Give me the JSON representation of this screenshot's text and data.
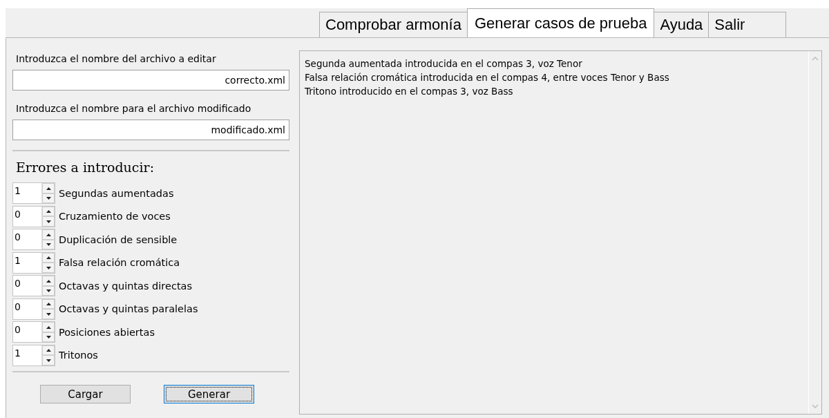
{
  "tabs": [
    {
      "label": "Comprobar armonía",
      "selected": false
    },
    {
      "label": "Generar casos de prueba",
      "selected": true
    },
    {
      "label": "Ayuda",
      "selected": false
    },
    {
      "label": "Salir",
      "selected": false
    }
  ],
  "source_file": {
    "label": "Introduzca el nombre del archivo a editar",
    "value": "correcto.xml"
  },
  "target_file": {
    "label": "Introduzca el nombre para el archivo modificado",
    "value": "modificado.xml"
  },
  "errors_heading": "Errores a introducir:",
  "errors": [
    {
      "value": "1",
      "label": "Segundas aumentadas"
    },
    {
      "value": "0",
      "label": "Cruzamiento de voces"
    },
    {
      "value": "0",
      "label": "Duplicación de sensible"
    },
    {
      "value": "1",
      "label": "Falsa relación cromática"
    },
    {
      "value": "0",
      "label": "Octavas y quintas directas"
    },
    {
      "value": "0",
      "label": "Octavas y quintas paralelas"
    },
    {
      "value": "0",
      "label": "Posiciones abiertas"
    },
    {
      "value": "1",
      "label": "Tritonos"
    }
  ],
  "buttons": [
    {
      "label": "Cargar",
      "focused": false
    },
    {
      "label": "Generar",
      "focused": true
    }
  ],
  "output_lines": [
    "Segunda aumentada introducida en el compas 3, voz Tenor",
    "Falsa relación cromática introducida en el compas 4, entre voces Tenor y Bass",
    "Tritono introducido en el compas 3, voz Bass"
  ]
}
